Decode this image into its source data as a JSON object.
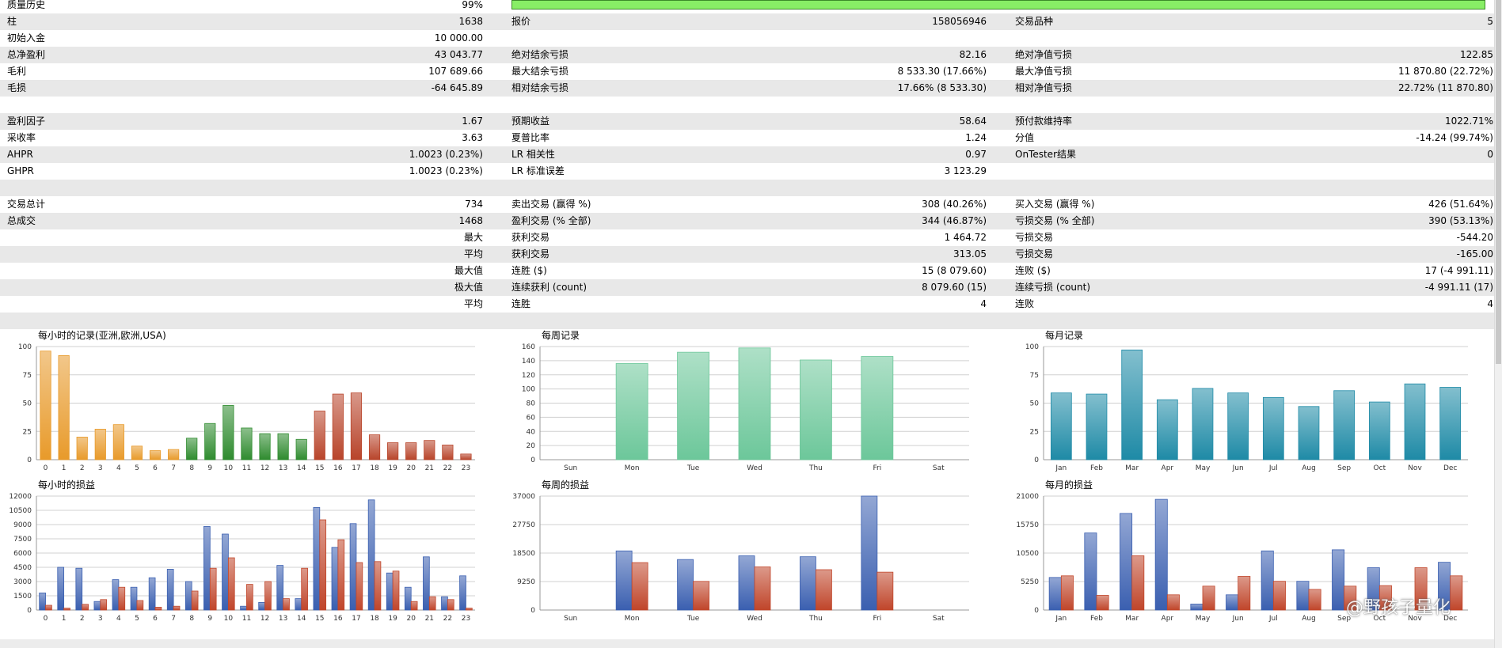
{
  "stats": {
    "rows": [
      {
        "c1l": "质量历史",
        "c1v": "99%",
        "bar": true
      },
      {
        "c1l": "柱",
        "c1v": "1638",
        "c2l": "报价",
        "c2v": "158056946",
        "c3l": "交易品种",
        "c3v": "5"
      },
      {
        "c1l": "初始入金",
        "c1v": "10 000.00"
      },
      {
        "c1l": "总净盈利",
        "c1v": "43 043.77",
        "c2l": "绝对结余亏损",
        "c2v": "82.16",
        "c3l": "绝对净值亏损",
        "c3v": "122.85"
      },
      {
        "c1l": "毛利",
        "c1v": "107 689.66",
        "c2l": "最大结余亏损",
        "c2v": "8 533.30 (17.66%)",
        "c3l": "最大净值亏损",
        "c3v": "11 870.80 (22.72%)"
      },
      {
        "c1l": "毛损",
        "c1v": "-64 645.89",
        "c2l": "相对结余亏损",
        "c2v": "17.66% (8 533.30)",
        "c3l": "相对净值亏损",
        "c3v": "22.72% (11 870.80)"
      },
      {},
      {
        "c1l": "盈利因子",
        "c1v": "1.67",
        "c2l": "预期收益",
        "c2v": "58.64",
        "c3l": "预付款维持率",
        "c3v": "1022.71%"
      },
      {
        "c1l": "采收率",
        "c1v": "3.63",
        "c2l": "夏普比率",
        "c2v": "1.24",
        "c3l": "分值",
        "c3v": "-14.24 (99.74%)"
      },
      {
        "c1l": "AHPR",
        "c1v": "1.0023 (0.23%)",
        "c2l": "LR 相关性",
        "c2v": "0.97",
        "c3l": "OnTester结果",
        "c3v": "0"
      },
      {
        "c1l": "GHPR",
        "c1v": "1.0023 (0.23%)",
        "c2l": "LR 标准误差",
        "c2v": "3 123.29"
      },
      {},
      {
        "c1l": "交易总计",
        "c1v": "734",
        "c2l": "卖出交易 (赢得 %)",
        "c2v": "308 (40.26%)",
        "c3l": "买入交易 (赢得 %)",
        "c3v": "426 (51.64%)"
      },
      {
        "c1l": "总成交",
        "c1v": "1468",
        "c2l": "盈利交易 (% 全部)",
        "c2v": "344 (46.87%)",
        "c3l": "亏损交易 (% 全部)",
        "c3v": "390 (53.13%)"
      },
      {
        "c1v": "最大",
        "c2l": "获利交易",
        "c2v": "1 464.72",
        "c3l": "亏损交易",
        "c3v": "-544.20"
      },
      {
        "c1v": "平均",
        "c2l": "获利交易",
        "c2v": "313.05",
        "c3l": "亏损交易",
        "c3v": "-165.00"
      },
      {
        "c1v": "最大值",
        "c2l": "连胜 ($)",
        "c2v": "15 (8 079.60)",
        "c3l": "连败 ($)",
        "c3v": "17 (-4 991.11)"
      },
      {
        "c1v": "极大值",
        "c2l": "连续获利 (count)",
        "c2v": "8 079.60 (15)",
        "c3l": "连续亏损 (count)",
        "c3v": "-4 991.11 (17)"
      },
      {
        "c1v": "平均",
        "c2l": "连胜",
        "c2v": "4",
        "c3l": "连败",
        "c3v": "4"
      },
      {}
    ],
    "quality_bar_fill": 0.99
  },
  "colors": {
    "orange": "#e89a2a",
    "green": "#2e8b2e",
    "red_bar": "#b8442a",
    "mint": "#6cc79a",
    "teal": "#1e8aa6",
    "blue": "#3a5fb0",
    "loss_red": "#c0452a",
    "grid": "#d0d0d0",
    "quality_bar": "#88ee66"
  },
  "chart_data": [
    {
      "type": "bar",
      "title": "每小时的记录(亚洲,欧洲,USA)",
      "ylim": [
        0,
        100
      ],
      "yticks": [
        "100",
        "75",
        "50",
        "25",
        "0"
      ],
      "categories": [
        "0",
        "1",
        "2",
        "3",
        "4",
        "5",
        "6",
        "7",
        "8",
        "9",
        "10",
        "11",
        "12",
        "13",
        "14",
        "15",
        "16",
        "17",
        "18",
        "19",
        "20",
        "21",
        "22",
        "23"
      ],
      "values": [
        96,
        92,
        20,
        27,
        31,
        12,
        8,
        9,
        19,
        32,
        48,
        28,
        23,
        23,
        18,
        43,
        58,
        59,
        22,
        15,
        15,
        17,
        13,
        5
      ],
      "colors": [
        "orange",
        "orange",
        "orange",
        "orange",
        "orange",
        "orange",
        "orange",
        "orange",
        "green",
        "green",
        "green",
        "green",
        "green",
        "green",
        "green",
        "red_bar",
        "red_bar",
        "red_bar",
        "red_bar",
        "red_bar",
        "red_bar",
        "red_bar",
        "red_bar",
        "red_bar"
      ]
    },
    {
      "type": "bar",
      "title": "每周记录",
      "ylim": [
        0,
        160
      ],
      "yticks": [
        "160",
        "140",
        "120",
        "100",
        "80",
        "60",
        "40",
        "20",
        "0"
      ],
      "categories": [
        "Sun",
        "Mon",
        "Tue",
        "Wed",
        "Thu",
        "Fri",
        "Sat"
      ],
      "values": [
        0,
        136,
        152,
        158,
        141,
        146,
        0
      ],
      "color": "mint"
    },
    {
      "type": "bar",
      "title": "每月记录",
      "ylim": [
        0,
        100
      ],
      "yticks": [
        "100",
        "75",
        "50",
        "25",
        "0"
      ],
      "categories": [
        "Jan",
        "Feb",
        "Mar",
        "Apr",
        "May",
        "Jun",
        "Jul",
        "Aug",
        "Sep",
        "Oct",
        "Nov",
        "Dec"
      ],
      "values": [
        59,
        58,
        97,
        53,
        63,
        59,
        55,
        47,
        61,
        51,
        67,
        64
      ],
      "color": "teal"
    },
    {
      "type": "bar",
      "title": "每小时的损益",
      "ylim": [
        0,
        12000
      ],
      "yticks": [
        "12000",
        "10500",
        "9000",
        "7500",
        "6000",
        "4500",
        "3000",
        "1500",
        "0"
      ],
      "categories": [
        "0",
        "1",
        "2",
        "3",
        "4",
        "5",
        "6",
        "7",
        "8",
        "9",
        "10",
        "11",
        "12",
        "13",
        "14",
        "15",
        "16",
        "17",
        "18",
        "19",
        "20",
        "21",
        "22",
        "23"
      ],
      "series": [
        {
          "color": "blue",
          "values": [
            1800,
            4500,
            4400,
            900,
            3200,
            2400,
            3400,
            4300,
            3000,
            8800,
            8000,
            400,
            800,
            4700,
            1200,
            10800,
            6600,
            9100,
            11600,
            3900,
            2400,
            5600,
            1400,
            3600
          ]
        },
        {
          "color": "loss_red",
          "values": [
            500,
            200,
            600,
            1100,
            2400,
            1000,
            300,
            400,
            2000,
            4400,
            5500,
            2700,
            3000,
            1200,
            4400,
            9500,
            7400,
            5000,
            5100,
            4100,
            900,
            1400,
            1100,
            200
          ]
        }
      ]
    },
    {
      "type": "bar",
      "title": "每周的损益",
      "ylim": [
        0,
        37000
      ],
      "yticks": [
        "37000",
        "27750",
        "18500",
        "9250",
        "0"
      ],
      "categories": [
        "Sun",
        "Mon",
        "Tue",
        "Wed",
        "Thu",
        "Fri",
        "Sat"
      ],
      "series": [
        {
          "color": "blue",
          "values": [
            0,
            19200,
            16400,
            17600,
            17300,
            37000,
            0
          ]
        },
        {
          "color": "loss_red",
          "values": [
            0,
            15400,
            9300,
            14000,
            13100,
            12300,
            0
          ]
        }
      ]
    },
    {
      "type": "bar",
      "title": "每月的损益",
      "ylim": [
        0,
        21000
      ],
      "yticks": [
        "21000",
        "15750",
        "10500",
        "5250",
        "0"
      ],
      "categories": [
        "Jan",
        "Feb",
        "Mar",
        "Apr",
        "May",
        "Jun",
        "Jul",
        "Aug",
        "Sep",
        "Oct",
        "Nov",
        "Dec"
      ],
      "series": [
        {
          "color": "blue",
          "values": [
            6000,
            14200,
            17800,
            20400,
            1100,
            2800,
            10900,
            5300,
            11100,
            7800,
            0,
            8800
          ]
        },
        {
          "color": "loss_red",
          "values": [
            6300,
            2700,
            10000,
            2800,
            4400,
            6200,
            5300,
            3800,
            4400,
            4500,
            7800,
            6300
          ]
        }
      ]
    }
  ],
  "watermark": "@野孩子量化"
}
